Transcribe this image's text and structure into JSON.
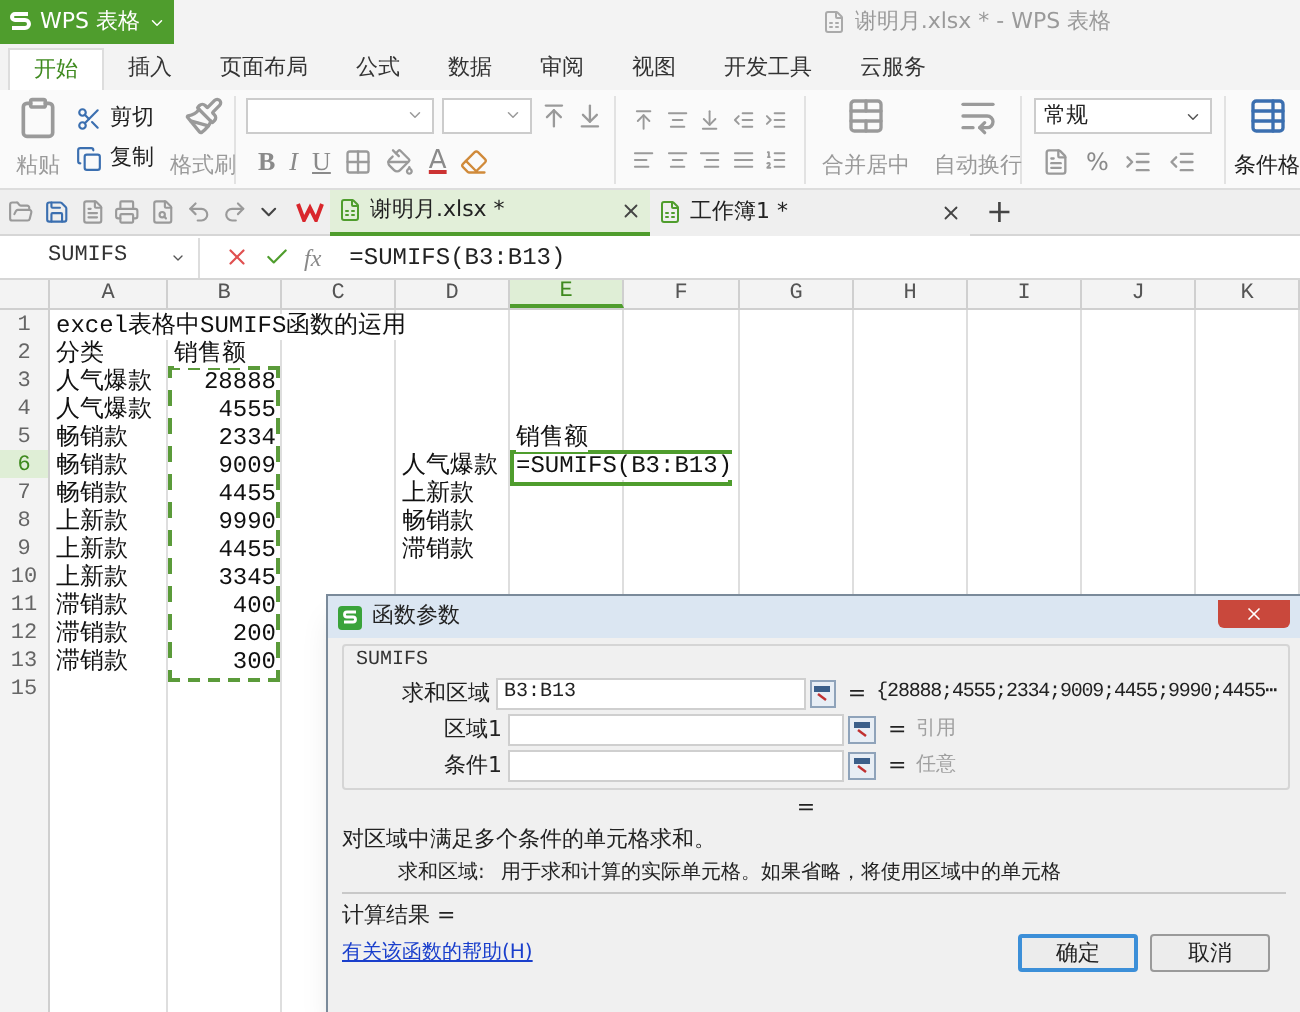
{
  "app_menu": {
    "label": "WPS 表格"
  },
  "window_title": "谢明月.xlsx * - WPS 表格",
  "ribbon_tabs": [
    {
      "label": "开始",
      "selected": true
    },
    {
      "label": "插入",
      "selected": false
    },
    {
      "label": "页面布局",
      "selected": false
    },
    {
      "label": "公式",
      "selected": false
    },
    {
      "label": "数据",
      "selected": false
    },
    {
      "label": "审阅",
      "selected": false
    },
    {
      "label": "视图",
      "selected": false
    },
    {
      "label": "开发工具",
      "selected": false
    },
    {
      "label": "云服务",
      "selected": false
    }
  ],
  "ribbon": {
    "paste": {
      "label": "粘贴",
      "disabled": true
    },
    "cut": {
      "label": "剪切",
      "disabled": false
    },
    "copy": {
      "label": "复制",
      "disabled": false
    },
    "format_painter": {
      "label": "格式刷",
      "disabled": true
    },
    "font_buttons": [
      {
        "label": "B"
      },
      {
        "label": "I"
      },
      {
        "label": "U"
      }
    ],
    "font_color": "A",
    "merge": {
      "label": "合并居中",
      "disabled": true
    },
    "wrap": {
      "label": "自动换行",
      "disabled": true
    },
    "number_format": "常规",
    "percent": "%",
    "conditional_format": "条件格"
  },
  "doc_tabs": [
    {
      "label": "谢明月.xlsx *",
      "selected": true
    },
    {
      "label": "工作簿1 *",
      "selected": false
    }
  ],
  "new_tab": "+",
  "formula_bar": {
    "name_box": "SUMIFS",
    "fx": "fx",
    "formula": "=SUMIFS(B3:B13)"
  },
  "sheet": {
    "columns": [
      {
        "label": "A",
        "selected": false
      },
      {
        "label": "B",
        "selected": false
      },
      {
        "label": "C",
        "selected": false
      },
      {
        "label": "D",
        "selected": false
      },
      {
        "label": "E",
        "selected": true
      },
      {
        "label": "F",
        "selected": false
      },
      {
        "label": "G",
        "selected": false
      },
      {
        "label": "H",
        "selected": false
      },
      {
        "label": "I",
        "selected": false
      },
      {
        "label": "J",
        "selected": false
      },
      {
        "label": "K",
        "selected": false
      }
    ],
    "rows": [
      {
        "label": "1",
        "selected": false,
        "cells": [
          {
            "text": "excel表格中SUMIFS函数的运用"
          }
        ]
      },
      {
        "label": "2",
        "selected": false,
        "cells": [
          {
            "text": "分类"
          },
          {
            "text": "销售额"
          }
        ]
      },
      {
        "label": "3",
        "selected": false,
        "cells": [
          {
            "text": "人气爆款"
          },
          {
            "text": "28888",
            "kind": "number",
            "marked": true
          }
        ]
      },
      {
        "label": "4",
        "selected": false,
        "cells": [
          {
            "text": "人气爆款"
          },
          {
            "text": "4555",
            "kind": "number",
            "marked": true
          }
        ]
      },
      {
        "label": "5",
        "selected": false,
        "cells": [
          {
            "text": "畅销款"
          },
          {
            "text": "2334",
            "kind": "number",
            "marked": true
          },
          {},
          {},
          {
            "text": "销售额"
          }
        ]
      },
      {
        "label": "6",
        "selected": true,
        "cells": [
          {
            "text": "畅销款"
          },
          {
            "text": "9009",
            "kind": "number",
            "marked": true
          },
          {},
          {
            "text": "人气爆款"
          },
          {
            "text": "=SUMIFS(B3:B13)",
            "active": true
          }
        ]
      },
      {
        "label": "7",
        "selected": false,
        "cells": [
          {
            "text": "畅销款"
          },
          {
            "text": "4455",
            "kind": "number",
            "marked": true
          },
          {},
          {
            "text": "上新款"
          }
        ]
      },
      {
        "label": "8",
        "selected": false,
        "cells": [
          {
            "text": "上新款"
          },
          {
            "text": "9990",
            "kind": "number",
            "marked": true
          },
          {},
          {
            "text": "畅销款"
          }
        ]
      },
      {
        "label": "9",
        "selected": false,
        "cells": [
          {
            "text": "上新款"
          },
          {
            "text": "4455",
            "kind": "number",
            "marked": true
          },
          {},
          {
            "text": "滞销款"
          }
        ]
      },
      {
        "label": "10",
        "selected": false,
        "cells": [
          {
            "text": "上新款"
          },
          {
            "text": "3345",
            "kind": "number",
            "marked": true
          }
        ]
      },
      {
        "label": "11",
        "selected": false,
        "cells": [
          {
            "text": "滞销款"
          },
          {
            "text": "400",
            "kind": "number",
            "marked": true
          }
        ]
      },
      {
        "label": "12",
        "selected": false,
        "cells": [
          {
            "text": "滞销款"
          },
          {
            "text": "200",
            "kind": "number",
            "marked": true
          }
        ]
      },
      {
        "label": "13",
        "selected": false,
        "cells": [
          {
            "text": "滞销款"
          },
          {
            "text": "300",
            "kind": "number",
            "marked": true
          }
        ]
      },
      {
        "label": "15",
        "selected": false,
        "cells": []
      }
    ]
  },
  "dialog": {
    "title": "函数参数",
    "function_name": "SUMIFS",
    "fields": [
      {
        "label": "求和区域",
        "value": "B3:B13",
        "equals": "=",
        "result": "{28888;4555;2334;9009;4455;9990;4455⋯",
        "kind": "value"
      },
      {
        "label": "区域1",
        "equals": "=",
        "result": "引用",
        "kind": "type"
      },
      {
        "label": "条件1",
        "equals": "=",
        "result": "任意",
        "kind": "type"
      }
    ],
    "formula_result": "=",
    "description": "对区域中满足多个条件的单元格求和。",
    "argument_name": "求和区域:",
    "argument_help": "用于求和计算的实际单元格。如果省略，将使用区域中的单元格",
    "calc_result": "计算结果 =",
    "help_link": "有关该函数的帮助(H)",
    "buttons": [
      {
        "label": "确定",
        "default": true
      },
      {
        "label": "取消",
        "default": false
      }
    ]
  }
}
